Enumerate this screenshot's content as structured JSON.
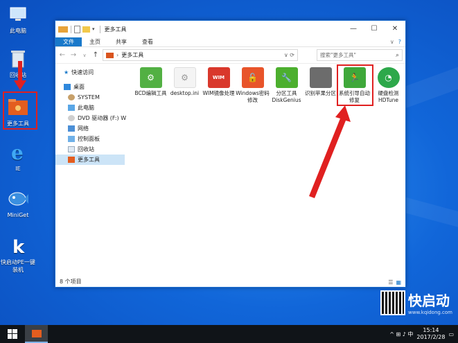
{
  "desktop": {
    "icons": [
      {
        "label": "此电脑",
        "icon": "computer-icon"
      },
      {
        "label": "回收站",
        "icon": "recycle-bin-icon"
      },
      {
        "label": "更多工具",
        "icon": "tools-folder-icon"
      },
      {
        "label": "IE",
        "icon": "ie-icon"
      },
      {
        "label": "MiniGet",
        "icon": "miniget-fish-icon"
      },
      {
        "label": "快启动PE一键装机",
        "icon": "kqidong-k-icon"
      }
    ],
    "annotation_color": "#e02020"
  },
  "window": {
    "title": "更多工具",
    "controls": {
      "minimize": "—",
      "maximize": "☐",
      "close": "✕"
    },
    "ribbon_tabs": [
      "文件",
      "主页",
      "共享",
      "查看"
    ],
    "address": {
      "path": "更多工具"
    },
    "search": {
      "placeholder": "搜索\"更多工具\""
    },
    "nav": {
      "quick_access": "快速访问",
      "desktop": "桌面",
      "items": [
        "SYSTEM",
        "此电脑",
        "DVD 驱动器 (F:) W",
        "网络",
        "控制面板",
        "回收站",
        "更多工具"
      ]
    },
    "files": [
      {
        "label": "BCD编辑工具",
        "color": "#52b043",
        "icon": "gear-icon"
      },
      {
        "label": "desktop.ini",
        "color": "#f0f0f0",
        "icon": "ini-file-icon"
      },
      {
        "label": "WIM镜像处理",
        "color": "#d9382c",
        "icon": "wim-icon"
      },
      {
        "label": "Windows密码修改",
        "color": "#e8542a",
        "icon": "lock-icon"
      },
      {
        "label": "分区工具DiskGenius",
        "color": "#4caf2e",
        "icon": "wrench-icon"
      },
      {
        "label": "识别苹果分区",
        "color": "#6c6c6c",
        "icon": "apple-icon"
      },
      {
        "label": "系统引导自动修复",
        "color": "#3fa83a",
        "icon": "running-man-icon"
      },
      {
        "label": "硬盘检测HDTune",
        "color": "#2da84a",
        "icon": "disk-check-icon"
      }
    ],
    "status": "8 个项目"
  },
  "taskbar": {
    "time": "15:14",
    "date": "2017/2/28",
    "tray_text": "^ ⊞ ♪ 中"
  },
  "brand": {
    "name": "快启动",
    "url": "www.kqidong.com"
  }
}
